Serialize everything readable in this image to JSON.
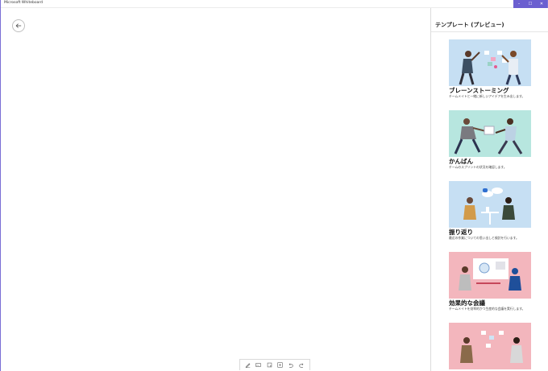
{
  "app": {
    "title": "Microsoft Whiteboard"
  },
  "window_controls": {
    "minimize": "–",
    "maximize": "☐",
    "close": "✕"
  },
  "panel": {
    "title": "テンプレート (プレビュー)",
    "templates": [
      {
        "name": "ブレーンストーミング",
        "description": "チームメイトと一緒に新しいアイデアを生み出します。",
        "bg": "#c6dff3"
      },
      {
        "name": "かんばん",
        "description": "チームのスプリントの状況を確認します。",
        "bg": "#b7e6df"
      },
      {
        "name": "振り返り",
        "description": "最近の作業についての思い出しと検討を行います。",
        "bg": "#c6dff3"
      },
      {
        "name": "効果的な会議",
        "description": "チームメイトを効率的かつ生産的な会議を実行します。",
        "bg": "#f3b6bd"
      },
      {
        "name": "",
        "description": "",
        "bg": "#f3b6bd"
      }
    ]
  },
  "colors": {
    "accent": "#6b5fd0"
  }
}
